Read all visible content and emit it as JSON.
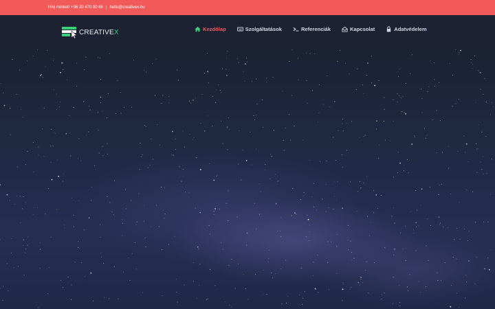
{
  "topbar": {
    "call_text": "Hívj minket! +36 20 470 60 66",
    "separator": "|",
    "email": "hello@creativex.hu"
  },
  "logo": {
    "brand_main": "CREATIVE",
    "brand_accent": "X"
  },
  "nav": {
    "items": [
      {
        "label": "Kezdőlap",
        "icon": "home-icon",
        "active": true
      },
      {
        "label": "Szolgáltatások",
        "icon": "keyboard-icon",
        "active": false
      },
      {
        "label": "Referenciák",
        "icon": "terminal-icon",
        "active": false
      },
      {
        "label": "Kapcsolat",
        "icon": "envelope-open-icon",
        "active": false
      },
      {
        "label": "Adatvédelem",
        "icon": "lock-icon",
        "active": false
      }
    ]
  },
  "colors": {
    "topbar_bg": "#f25a5a",
    "navbar_bg": "#1d2233",
    "active_nav": "#f25a5a",
    "accent_green": "#3ccf7a",
    "hero_sky": "#1f2947"
  },
  "hero": {
    "image": "starry-night-sky"
  }
}
